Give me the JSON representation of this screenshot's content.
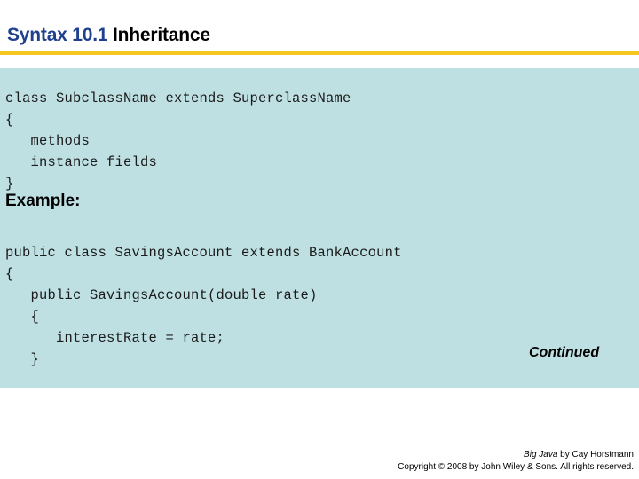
{
  "slide": {
    "title": {
      "syntax_label": "Syntax 10.1",
      "topic_label": " Inheritance"
    },
    "accent_colors": {
      "title_blue": "#1f3f8f",
      "rule_yellow": "#f5c821",
      "panel_cyan": "#bfe0e3"
    },
    "syntax_code": "class SubclassName extends SuperclassName\n{\n   methods\n   instance fields\n}",
    "example_heading": "Example:",
    "example_code": "public class SavingsAccount extends BankAccount\n{\n   public SavingsAccount(double rate)\n   {\n      interestRate = rate;\n   }",
    "continued_label": "Continued",
    "footer": {
      "book_title": "Big Java",
      "author_line": " by Cay Horstmann",
      "copyright_line": "Copyright © 2008 by John Wiley & Sons.  All rights reserved."
    }
  }
}
